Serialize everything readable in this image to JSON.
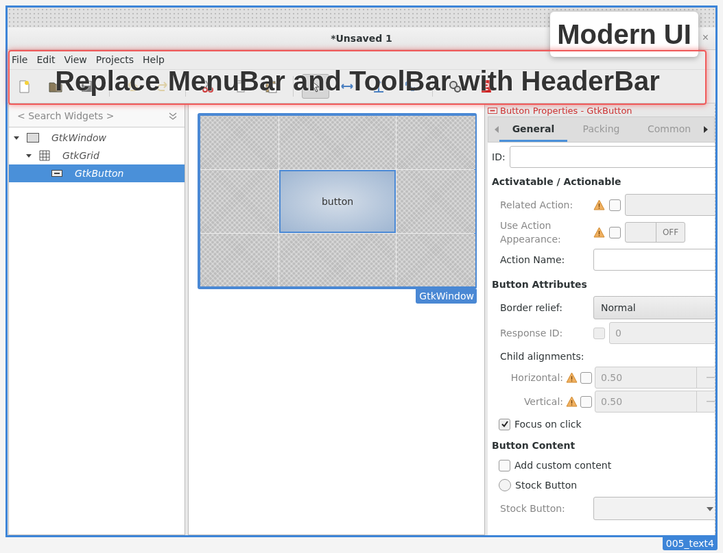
{
  "annotations": {
    "badge": "Modern UI",
    "callout": "Replace MenuBar and ToolBar with HeaderBar",
    "tag": "005_text4"
  },
  "window": {
    "title": "*Unsaved 1",
    "close": "×"
  },
  "menu": [
    "File",
    "Edit",
    "View",
    "Projects",
    "Help"
  ],
  "toolbar": [
    [
      {
        "kind": "new",
        "selected": false,
        "disabled": false
      },
      {
        "kind": "open",
        "selected": false,
        "disabled": false
      },
      {
        "kind": "save",
        "selected": false,
        "disabled": false
      }
    ],
    [
      {
        "kind": "undo",
        "selected": false,
        "disabled": true
      },
      {
        "kind": "redo",
        "selected": false,
        "disabled": true
      }
    ],
    [
      {
        "kind": "cut",
        "selected": false,
        "disabled": false
      },
      {
        "kind": "copy",
        "selected": false,
        "disabled": false
      },
      {
        "kind": "paste",
        "selected": false,
        "disabled": false
      }
    ],
    [
      {
        "kind": "pointer",
        "selected": true,
        "disabled": false
      },
      {
        "kind": "drag",
        "selected": false,
        "disabled": false
      },
      {
        "kind": "margin",
        "selected": false,
        "disabled": false
      },
      {
        "kind": "align",
        "selected": false,
        "disabled": false
      }
    ],
    [
      {
        "kind": "preview",
        "selected": false,
        "disabled": false
      },
      {
        "kind": "registration",
        "selected": false,
        "disabled": false
      }
    ]
  ],
  "search": {
    "placeholder": "< Search Widgets >"
  },
  "tree": [
    {
      "label": "GtkWindow",
      "kind": "window",
      "expanded": true,
      "selected": false,
      "children": [
        {
          "label": "GtkGrid",
          "kind": "grid",
          "expanded": true,
          "selected": false,
          "children": [
            {
              "label": "GtkButton",
              "kind": "button",
              "selected": true
            }
          ]
        }
      ]
    }
  ],
  "canvas": {
    "button_label": "button",
    "window_tag": "GtkWindow"
  },
  "properties": {
    "header": "Button Properties - GtkButton",
    "tabs": [
      {
        "label": "General",
        "selected": true
      },
      {
        "label": "Packing",
        "selected": false
      },
      {
        "label": "Common",
        "selected": false
      }
    ],
    "rows": [
      {
        "kind": "id",
        "label": "ID:"
      },
      {
        "kind": "heading",
        "label": "Activatable / Actionable"
      },
      {
        "kind": "entry",
        "label": "Related Action:",
        "warning": true,
        "checked": false,
        "disabled": true
      },
      {
        "kind": "switch",
        "label": "Use Action Appearance:",
        "warning": true,
        "checked": false,
        "disabled": true,
        "value": "OFF"
      },
      {
        "kind": "entry",
        "label": "Action Name:",
        "disabled": false
      },
      {
        "kind": "heading",
        "label": "Button Attributes"
      },
      {
        "kind": "combo",
        "label": "Border relief:",
        "value": "Normal",
        "disabled": false
      },
      {
        "kind": "spin",
        "label": "Response ID:",
        "warning": false,
        "checked": false,
        "disabled": true,
        "value": "0"
      },
      {
        "kind": "label",
        "label": "Child alignments:"
      },
      {
        "kind": "align",
        "label": "Horizontal:",
        "warning": true,
        "checked": false,
        "disabled": true,
        "value": "0.50"
      },
      {
        "kind": "align",
        "label": "Vertical:",
        "warning": true,
        "checked": false,
        "disabled": true,
        "value": "0.50"
      },
      {
        "kind": "check",
        "label": "Focus on click",
        "checked": true
      },
      {
        "kind": "heading",
        "label": "Button Content"
      },
      {
        "kind": "check",
        "label": "Add custom content",
        "checked": false
      },
      {
        "kind": "radio",
        "label": "Stock Button",
        "selected": false
      },
      {
        "kind": "combo",
        "label": "Stock Button:",
        "disabled": true
      }
    ]
  }
}
